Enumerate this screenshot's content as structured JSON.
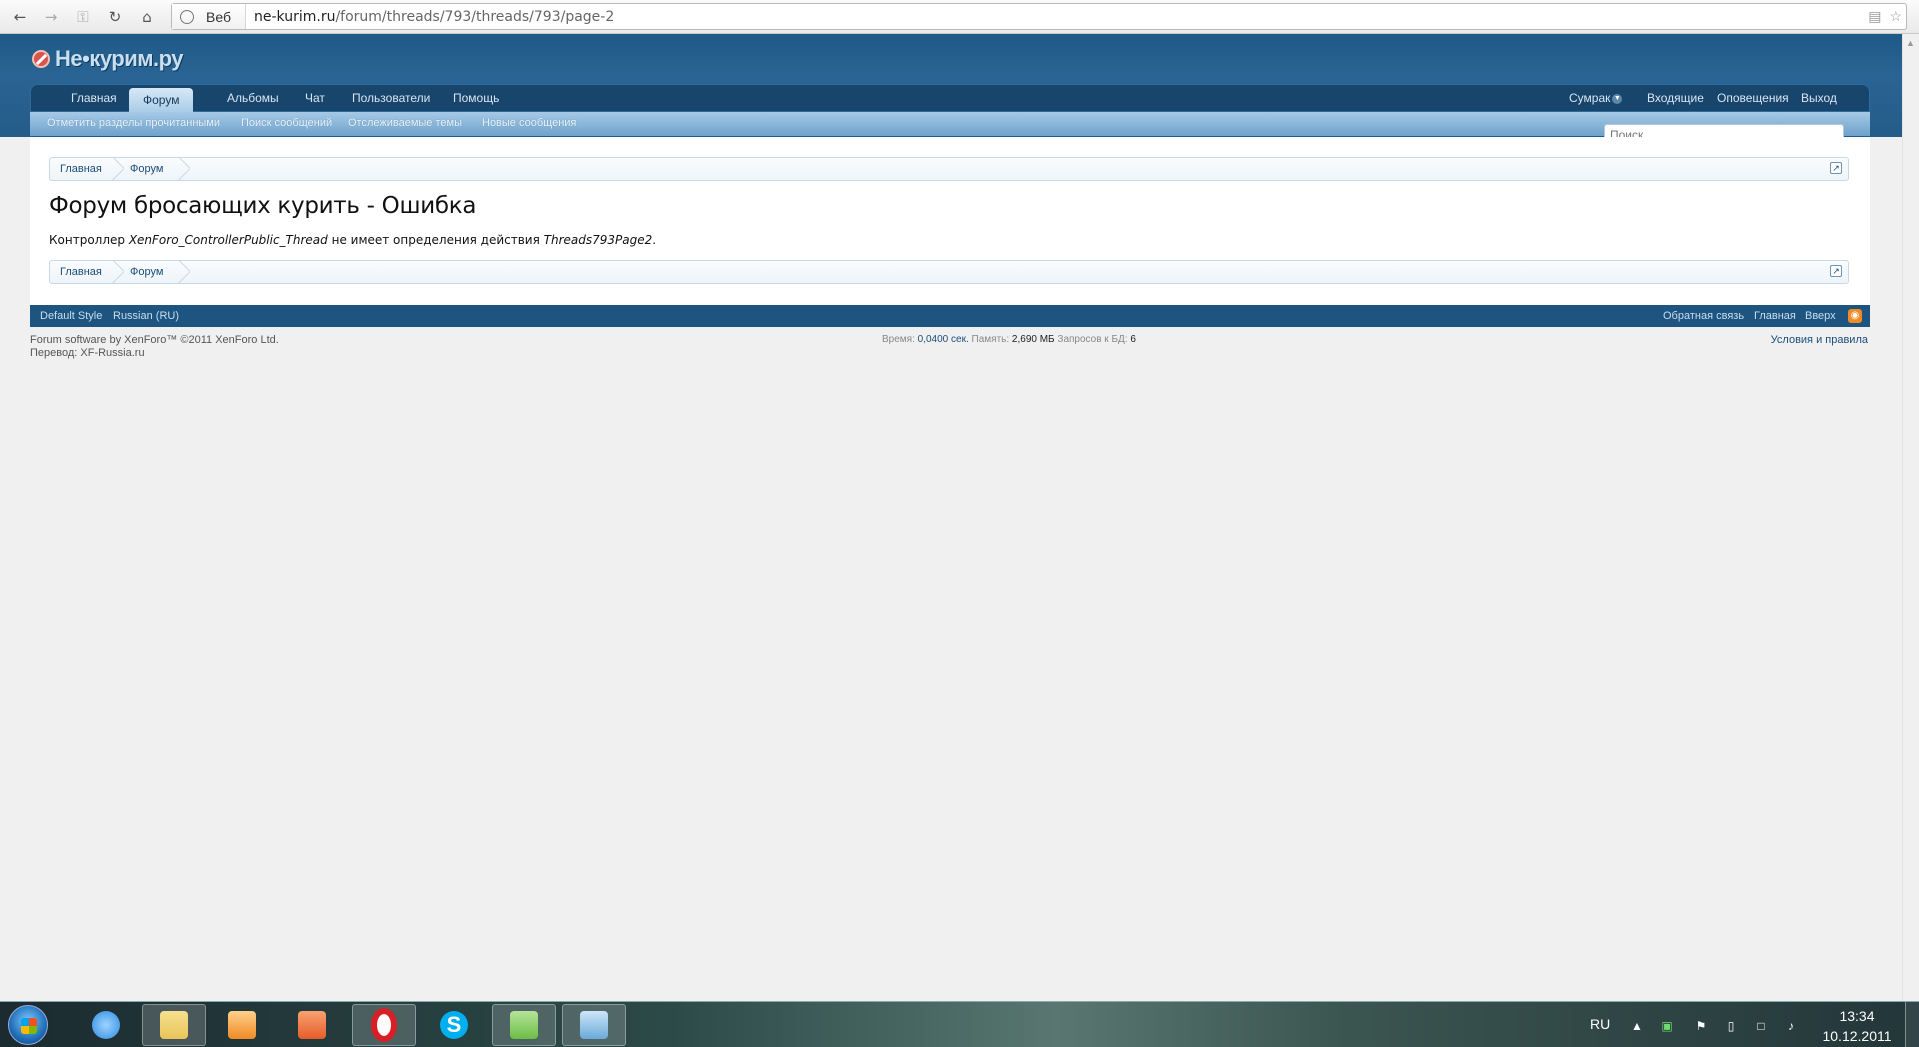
{
  "browser": {
    "scheme_label": "Веб",
    "url_host": "ne-kurim.ru",
    "url_path": "/forum/threads/793/threads/793/page-2"
  },
  "forum": {
    "logo_text": "Не•курим.ру",
    "nav_tabs": [
      {
        "label": "Главная"
      },
      {
        "label": "Форум",
        "active": true
      },
      {
        "label": "Альбомы"
      },
      {
        "label": "Чат"
      },
      {
        "label": "Пользователи"
      },
      {
        "label": "Помощь"
      }
    ],
    "user_menu": {
      "username": "Сумрак",
      "inbox": "Входящие",
      "alerts": "Оповещения",
      "logout": "Выход"
    },
    "subnav": [
      "Отметить разделы прочитанными",
      "Поиск сообщений",
      "Отслеживаемые темы",
      "Новые сообщения"
    ],
    "search_placeholder": "Поиск...",
    "breadcrumb": [
      "Главная",
      "Форум"
    ],
    "page_title": "Форум бросающих курить - Ошибка",
    "error": {
      "prefix": "Контроллер ",
      "controller": "XenForo_ControllerPublic_Thread",
      "middle": " не имеет определения действия ",
      "action": "Threads793Page2",
      "suffix": "."
    },
    "footer": {
      "style": "Default Style",
      "language": "Russian (RU)",
      "feedback": "Обратная связь",
      "home": "Главная",
      "top": "Вверх",
      "copyright": "Forum software by XenForo™ ©2011 XenForo Ltd.",
      "translation": "Перевод: XF-Russia.ru",
      "terms": "Условия и правила",
      "debug": {
        "time_label": "Время:",
        "time_value": "0,0400 сек.",
        "memory_label": "Память:",
        "memory_value": "2,690 МБ",
        "queries_label": "Запросов к БД:",
        "queries_value": "6"
      }
    }
  },
  "taskbar": {
    "language": "RU",
    "time": "13:34",
    "date": "10.12.2011",
    "apps": [
      {
        "name": "internet-explorer-icon",
        "color": "#2a8be0"
      },
      {
        "name": "explorer-folder-icon",
        "color": "#e8c35a"
      },
      {
        "name": "media-player-icon",
        "color": "#f08a24"
      },
      {
        "name": "office-icon",
        "color": "#e65c2b"
      },
      {
        "name": "opera-icon",
        "color": "#d91f26"
      },
      {
        "name": "skype-icon",
        "color": "#00aff0"
      },
      {
        "name": "task-manager-icon",
        "color": "#6cbd45"
      },
      {
        "name": "network-utility-icon",
        "color": "#6aa9d8"
      }
    ]
  }
}
